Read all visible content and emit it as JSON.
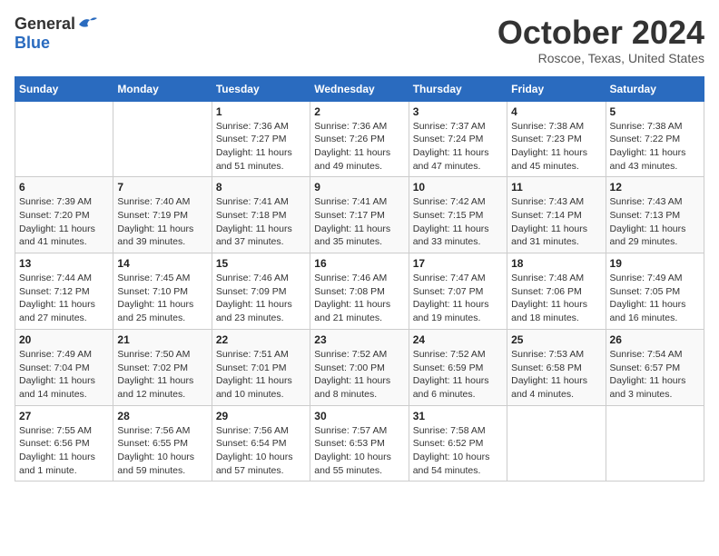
{
  "header": {
    "logo_general": "General",
    "logo_blue": "Blue",
    "month_title": "October 2024",
    "location": "Roscoe, Texas, United States"
  },
  "weekdays": [
    "Sunday",
    "Monday",
    "Tuesday",
    "Wednesday",
    "Thursday",
    "Friday",
    "Saturday"
  ],
  "weeks": [
    [
      {
        "day": "",
        "detail": ""
      },
      {
        "day": "",
        "detail": ""
      },
      {
        "day": "1",
        "detail": "Sunrise: 7:36 AM\nSunset: 7:27 PM\nDaylight: 11 hours and 51 minutes."
      },
      {
        "day": "2",
        "detail": "Sunrise: 7:36 AM\nSunset: 7:26 PM\nDaylight: 11 hours and 49 minutes."
      },
      {
        "day": "3",
        "detail": "Sunrise: 7:37 AM\nSunset: 7:24 PM\nDaylight: 11 hours and 47 minutes."
      },
      {
        "day": "4",
        "detail": "Sunrise: 7:38 AM\nSunset: 7:23 PM\nDaylight: 11 hours and 45 minutes."
      },
      {
        "day": "5",
        "detail": "Sunrise: 7:38 AM\nSunset: 7:22 PM\nDaylight: 11 hours and 43 minutes."
      }
    ],
    [
      {
        "day": "6",
        "detail": "Sunrise: 7:39 AM\nSunset: 7:20 PM\nDaylight: 11 hours and 41 minutes."
      },
      {
        "day": "7",
        "detail": "Sunrise: 7:40 AM\nSunset: 7:19 PM\nDaylight: 11 hours and 39 minutes."
      },
      {
        "day": "8",
        "detail": "Sunrise: 7:41 AM\nSunset: 7:18 PM\nDaylight: 11 hours and 37 minutes."
      },
      {
        "day": "9",
        "detail": "Sunrise: 7:41 AM\nSunset: 7:17 PM\nDaylight: 11 hours and 35 minutes."
      },
      {
        "day": "10",
        "detail": "Sunrise: 7:42 AM\nSunset: 7:15 PM\nDaylight: 11 hours and 33 minutes."
      },
      {
        "day": "11",
        "detail": "Sunrise: 7:43 AM\nSunset: 7:14 PM\nDaylight: 11 hours and 31 minutes."
      },
      {
        "day": "12",
        "detail": "Sunrise: 7:43 AM\nSunset: 7:13 PM\nDaylight: 11 hours and 29 minutes."
      }
    ],
    [
      {
        "day": "13",
        "detail": "Sunrise: 7:44 AM\nSunset: 7:12 PM\nDaylight: 11 hours and 27 minutes."
      },
      {
        "day": "14",
        "detail": "Sunrise: 7:45 AM\nSunset: 7:10 PM\nDaylight: 11 hours and 25 minutes."
      },
      {
        "day": "15",
        "detail": "Sunrise: 7:46 AM\nSunset: 7:09 PM\nDaylight: 11 hours and 23 minutes."
      },
      {
        "day": "16",
        "detail": "Sunrise: 7:46 AM\nSunset: 7:08 PM\nDaylight: 11 hours and 21 minutes."
      },
      {
        "day": "17",
        "detail": "Sunrise: 7:47 AM\nSunset: 7:07 PM\nDaylight: 11 hours and 19 minutes."
      },
      {
        "day": "18",
        "detail": "Sunrise: 7:48 AM\nSunset: 7:06 PM\nDaylight: 11 hours and 18 minutes."
      },
      {
        "day": "19",
        "detail": "Sunrise: 7:49 AM\nSunset: 7:05 PM\nDaylight: 11 hours and 16 minutes."
      }
    ],
    [
      {
        "day": "20",
        "detail": "Sunrise: 7:49 AM\nSunset: 7:04 PM\nDaylight: 11 hours and 14 minutes."
      },
      {
        "day": "21",
        "detail": "Sunrise: 7:50 AM\nSunset: 7:02 PM\nDaylight: 11 hours and 12 minutes."
      },
      {
        "day": "22",
        "detail": "Sunrise: 7:51 AM\nSunset: 7:01 PM\nDaylight: 11 hours and 10 minutes."
      },
      {
        "day": "23",
        "detail": "Sunrise: 7:52 AM\nSunset: 7:00 PM\nDaylight: 11 hours and 8 minutes."
      },
      {
        "day": "24",
        "detail": "Sunrise: 7:52 AM\nSunset: 6:59 PM\nDaylight: 11 hours and 6 minutes."
      },
      {
        "day": "25",
        "detail": "Sunrise: 7:53 AM\nSunset: 6:58 PM\nDaylight: 11 hours and 4 minutes."
      },
      {
        "day": "26",
        "detail": "Sunrise: 7:54 AM\nSunset: 6:57 PM\nDaylight: 11 hours and 3 minutes."
      }
    ],
    [
      {
        "day": "27",
        "detail": "Sunrise: 7:55 AM\nSunset: 6:56 PM\nDaylight: 11 hours and 1 minute."
      },
      {
        "day": "28",
        "detail": "Sunrise: 7:56 AM\nSunset: 6:55 PM\nDaylight: 10 hours and 59 minutes."
      },
      {
        "day": "29",
        "detail": "Sunrise: 7:56 AM\nSunset: 6:54 PM\nDaylight: 10 hours and 57 minutes."
      },
      {
        "day": "30",
        "detail": "Sunrise: 7:57 AM\nSunset: 6:53 PM\nDaylight: 10 hours and 55 minutes."
      },
      {
        "day": "31",
        "detail": "Sunrise: 7:58 AM\nSunset: 6:52 PM\nDaylight: 10 hours and 54 minutes."
      },
      {
        "day": "",
        "detail": ""
      },
      {
        "day": "",
        "detail": ""
      }
    ]
  ]
}
